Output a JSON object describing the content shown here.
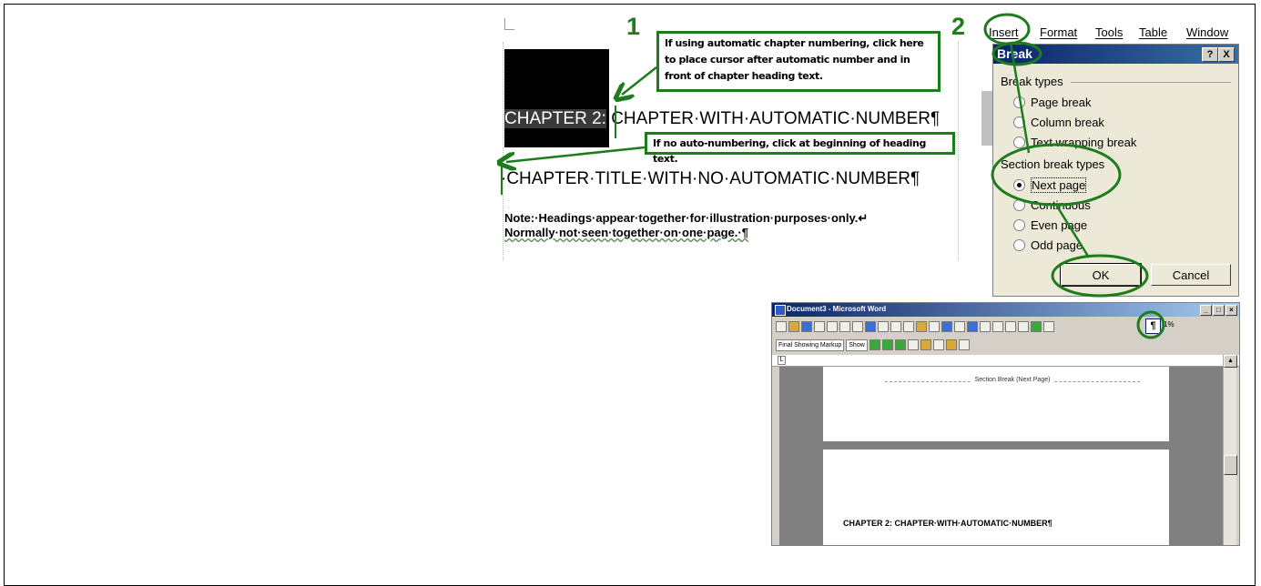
{
  "doc": {
    "pilcrow_top": "¶",
    "heading1_number": "CHAPTER 2:",
    "heading1_text": " CHAPTER·WITH·AUTOMATIC·NUMBER¶",
    "heading2": "·CHAPTER·TITLE·WITH·NO·AUTOMATIC·NUMBER¶",
    "note_line1": "Note:·Headings·appear·together·for·illustration·purposes·only.↵",
    "note_line2": "Normally·not·seen·together·on·one·page.·¶"
  },
  "callouts": {
    "step1_number": "1",
    "step2_number": "2",
    "step1_text": "If using automatic chapter numbering, click here to place cursor after automatic number and in front of chapter heading text.",
    "step1b_text": "If no auto-numbering, click at beginning of heading text."
  },
  "menu": {
    "items": [
      "Insert",
      "Format",
      "Tools",
      "Table",
      "Window"
    ]
  },
  "dialog": {
    "title": "Break",
    "help_btn": "?",
    "close_btn": "X",
    "group1_label": "Break types",
    "break_types": [
      "Page break",
      "Column break",
      "Text wrapping break"
    ],
    "group2_label": "Section break types",
    "section_types": [
      "Next page",
      "Continuous",
      "Even page",
      "Odd page"
    ],
    "selected_section_type": "Next page",
    "ok_label": "OK",
    "cancel_label": "Cancel"
  },
  "word_window": {
    "title": "Document3 - Microsoft Word",
    "markup_select": "Final Showing Markup",
    "show_label": "Show",
    "zoom": "1%",
    "show_hide_icon": "¶",
    "section_break_label": "Section Break (Next Page)",
    "section_break_pilcrow": "¶",
    "page2_heading": "CHAPTER 2: CHAPTER·WITH·AUTOMATIC·NUMBER¶"
  },
  "colors": {
    "annotation_green": "#1d7d1d",
    "dialog_bg": "#ece9d8",
    "titlebar_blue": "#0a246a"
  }
}
